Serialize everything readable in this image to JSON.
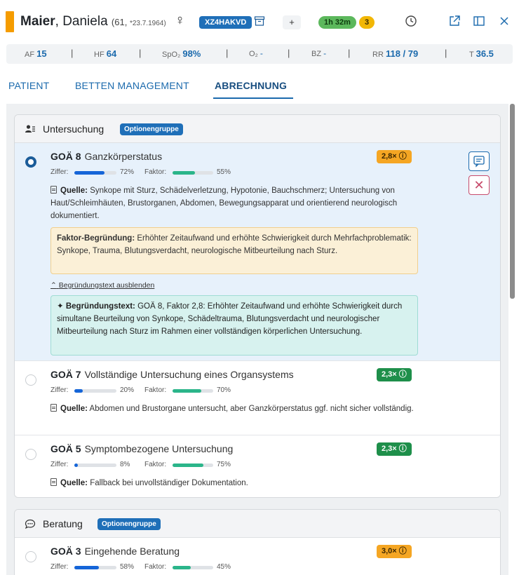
{
  "header": {
    "last_name": "Maier",
    "first_name": ", Daniela",
    "age": "(61,",
    "dob": "*23.7.1964)",
    "case_id": "XZ4HAKVD",
    "plus": "+",
    "timer": "1h 32m",
    "count": "3",
    "icons": [
      "female-icon",
      "archive-icon",
      "clock-icon",
      "external-link-icon",
      "panel-icon",
      "close-icon"
    ],
    "accent_color": "#f59c00"
  },
  "vitals": [
    {
      "label": "AF",
      "value": "15"
    },
    {
      "label": "HF",
      "value": "64"
    },
    {
      "label": "SpO₂",
      "value": "98%"
    },
    {
      "label": "O₂",
      "value": "-"
    },
    {
      "label": "BZ",
      "value": "-"
    },
    {
      "label": "RR",
      "value": "118 / 79"
    },
    {
      "label": "T",
      "value": "36.5"
    }
  ],
  "tabs": [
    {
      "label": "PATIENT",
      "active": false
    },
    {
      "label": "BETTEN MANAGEMENT",
      "active": false
    },
    {
      "label": "ABRECHNUNG",
      "active": true
    }
  ],
  "labels": {
    "ziffer": "Ziffer:",
    "faktor": "Faktor:",
    "quelle": "Quelle:",
    "faktor_begruendung": "Faktor-Begründung:",
    "begruendungstext": "Begründungstext:",
    "hide_reason": "Begründungstext ausblenden"
  },
  "groups": [
    {
      "title": "Untersuchung",
      "badge": "Optionengruppe",
      "items": [
        {
          "code": "GOÄ 8",
          "title": "Ganzkörperstatus",
          "factor": "2,8×",
          "factor_color": "orange",
          "selected": true,
          "ziffer_pct": 72,
          "ziffer_text": "72%",
          "faktor_pct": 55,
          "faktor_text": "55%",
          "source": "Synkope mit Sturz, Schädelverletzung, Hypotonie, Bauchschmerz; Untersuchung von Haut/Schleimhäuten, Brustorganen, Abdomen, Bewegungsapparat und orientierend neurologisch dokumentiert.",
          "factor_reason": "Erhöhter Zeitaufwand und erhöhte Schwierigkeit durch Mehrfachproblematik: Synkope, Trauma, Blutungsverdacht, neurologische Mitbeurteilung nach Sturz.",
          "reason_text": "GOÄ 8, Faktor 2,8: Erhöhter Zeitaufwand und erhöhte Schwierigkeit durch simultane Beurteilung von Synkope, Schädeltrauma, Blutungsverdacht und neurologischer Mitbeurteilung nach Sturz im Rahmen einer vollständigen körperlichen Untersuchung."
        },
        {
          "code": "GOÄ 7",
          "title": "Vollständige Untersuchung eines Organsystems",
          "factor": "2,3×",
          "factor_color": "green",
          "selected": false,
          "ziffer_pct": 20,
          "ziffer_text": "20%",
          "faktor_pct": 70,
          "faktor_text": "70%",
          "source": "Abdomen und Brustorgane untersucht, aber Ganzkörperstatus ggf. nicht sicher vollständig."
        },
        {
          "code": "GOÄ 5",
          "title": "Symptombezogene Untersuchung",
          "factor": "2,3×",
          "factor_color": "green",
          "selected": false,
          "ziffer_pct": 8,
          "ziffer_text": "8%",
          "faktor_pct": 75,
          "faktor_text": "75%",
          "source": "Fallback bei unvollständiger Dokumentation."
        }
      ]
    },
    {
      "title": "Beratung",
      "badge": "Optionengruppe",
      "items": [
        {
          "code": "GOÄ 3",
          "title": "Eingehende Beratung",
          "factor": "3,0×",
          "factor_color": "orange",
          "selected": false,
          "ziffer_pct": 58,
          "ziffer_text": "58%",
          "faktor_pct": 45,
          "faktor_text": "45%"
        }
      ]
    }
  ]
}
